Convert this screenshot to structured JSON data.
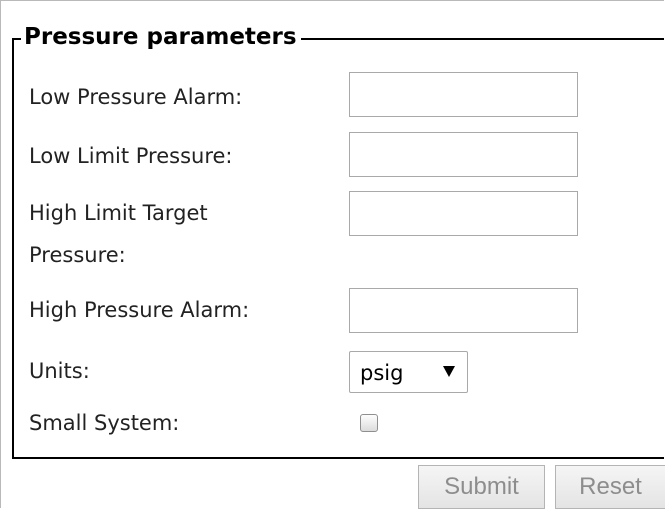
{
  "form": {
    "legend": "Pressure parameters",
    "fields": [
      {
        "label": "Low Pressure Alarm:",
        "value": ""
      },
      {
        "label": "Low Limit Pressure:",
        "value": ""
      },
      {
        "label_line1": "High Limit Target",
        "label_line2": "Pressure:",
        "value": ""
      },
      {
        "label": "High Pressure Alarm:",
        "value": ""
      }
    ],
    "units": {
      "label": "Units:",
      "selected": "psig"
    },
    "small_system": {
      "label": "Small System:",
      "checked": false
    },
    "submit_label": "Submit",
    "reset_label": "Reset"
  },
  "icons": {
    "dropdown": "chevron-down-icon",
    "checkbox": "checkbox-icon"
  }
}
